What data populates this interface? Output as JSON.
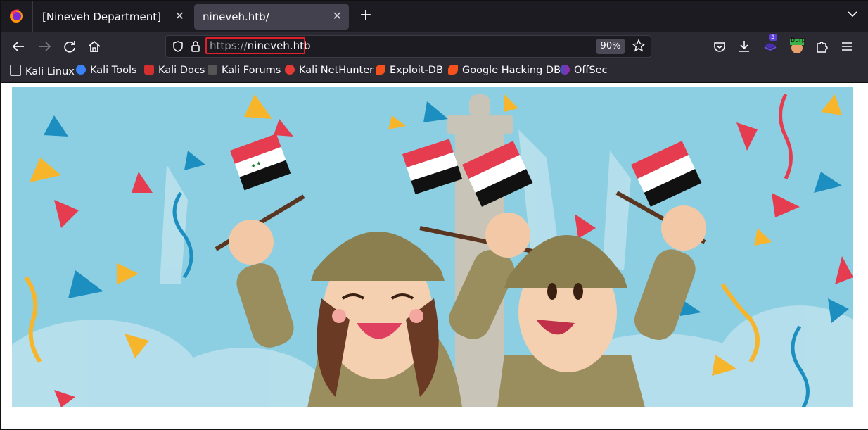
{
  "browser": {
    "tabs": [
      {
        "title": "[Nineveh Department]",
        "active": false
      },
      {
        "title": "nineveh.htb/",
        "active": true
      }
    ],
    "address": {
      "scheme": "https://",
      "host": "nineveh.htb",
      "zoom": "90%"
    },
    "extensions": {
      "badge_count": "5",
      "burp_label": "Burp"
    },
    "bookmarks": [
      {
        "label": "Kali Linux",
        "icon": "kali-dragon-icon",
        "color": "#ffffff"
      },
      {
        "label": "Kali Tools",
        "icon": "kali-tools-icon",
        "color": "#3b82f6"
      },
      {
        "label": "Kali Docs",
        "icon": "kali-docs-icon",
        "color": "#d32f2f"
      },
      {
        "label": "Kali Forums",
        "icon": "kali-forums-icon",
        "color": "#ffffff"
      },
      {
        "label": "Kali NetHunter",
        "icon": "nethunter-icon",
        "color": "#e53935"
      },
      {
        "label": "Exploit-DB",
        "icon": "exploit-db-icon",
        "color": "#f4511e"
      },
      {
        "label": "Google Hacking DB",
        "icon": "ghdb-icon",
        "color": "#f4511e"
      },
      {
        "label": "OffSec",
        "icon": "offsec-icon",
        "color": "#7b61ff"
      }
    ]
  },
  "page": {
    "banner": {
      "description_icon": "iraq-celebration-illustration"
    }
  },
  "colors": {
    "tabbar": "#1c1b22",
    "toolbar": "#2b2a33",
    "url_highlight": "#e0202c",
    "banner_sky": "#8ccfe2"
  }
}
